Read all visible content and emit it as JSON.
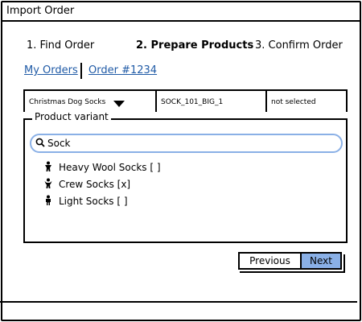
{
  "window": {
    "title": "Import Order"
  },
  "steps": [
    "1. Find Order",
    "2. Prepare Products",
    "3. Confirm Order"
  ],
  "active_step": 1,
  "breadcrumbs": [
    "My Orders",
    "Order #1234"
  ],
  "fields": {
    "product_select": "Christmas Dog Socks",
    "sku": "SOCK_101_BIG_1",
    "status": "not selected"
  },
  "variant_group": {
    "legend": "Product variant",
    "search_value": "Sock",
    "items": [
      {
        "label": "Heavy Wool Socks [ ]",
        "icon": "person-icon"
      },
      {
        "label": "Crew Socks [x]",
        "icon": "person-icon"
      },
      {
        "label": "Light Socks [ ]",
        "icon": "person-icon"
      }
    ]
  },
  "buttons": {
    "previous": "Previous",
    "next": "Next"
  },
  "colors": {
    "accent": "#8ab0e6",
    "link": "#1f5aa6"
  }
}
